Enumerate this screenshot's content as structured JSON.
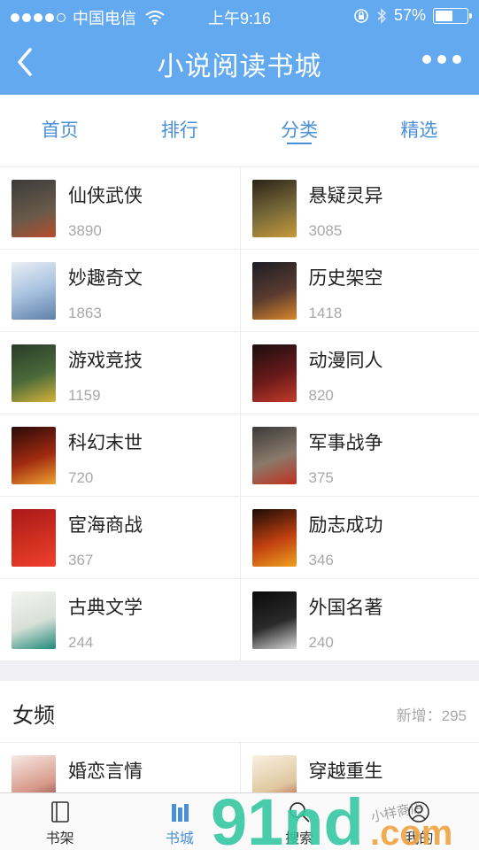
{
  "status_bar": {
    "carrier": "中国电信",
    "time": "上午9:16",
    "battery": "57%",
    "battery_level": 0.57
  },
  "nav": {
    "title": "小说阅读书城"
  },
  "tabs": [
    {
      "label": "首页"
    },
    {
      "label": "排行"
    },
    {
      "label": "分类"
    },
    {
      "label": "精选"
    }
  ],
  "categories": [
    {
      "title": "仙侠武侠",
      "count": "3890",
      "cover": "cover-xianxia"
    },
    {
      "title": "悬疑灵异",
      "count": "3085",
      "cover": "cover-xuanyi"
    },
    {
      "title": "妙趣奇文",
      "count": "1863",
      "cover": "cover-miaoqu"
    },
    {
      "title": "历史架空",
      "count": "1418",
      "cover": "cover-lishi"
    },
    {
      "title": "游戏竞技",
      "count": "1159",
      "cover": "cover-youxi"
    },
    {
      "title": "动漫同人",
      "count": "820",
      "cover": "cover-dongman"
    },
    {
      "title": "科幻末世",
      "count": "720",
      "cover": "cover-kehuan"
    },
    {
      "title": "军事战争",
      "count": "375",
      "cover": "cover-junshi"
    },
    {
      "title": "宦海商战",
      "count": "367",
      "cover": "cover-huanhai"
    },
    {
      "title": "励志成功",
      "count": "346",
      "cover": "cover-lizhi"
    },
    {
      "title": "古典文学",
      "count": "244",
      "cover": "cover-gudian"
    },
    {
      "title": "外国名著",
      "count": "240",
      "cover": "cover-waiguo"
    }
  ],
  "female_section": {
    "title": "女频",
    "new_count": "新增：295",
    "items": [
      {
        "title": "婚恋言情",
        "cover": "cover-hunlian"
      },
      {
        "title": "穿越重生",
        "cover": "cover-chuanyue"
      }
    ]
  },
  "tabbar": [
    {
      "label": "书架",
      "icon": "bookshelf-icon"
    },
    {
      "label": "书城",
      "icon": "bookstore-icon"
    },
    {
      "label": "搜索",
      "icon": "search-icon"
    },
    {
      "label": "我的",
      "icon": "profile-icon"
    }
  ],
  "watermark": {
    "logo": "91nd",
    "suffix": ".com",
    "note": "小样商店"
  },
  "colors": {
    "header": "#63a9f0",
    "accent": "#4a90d9"
  }
}
